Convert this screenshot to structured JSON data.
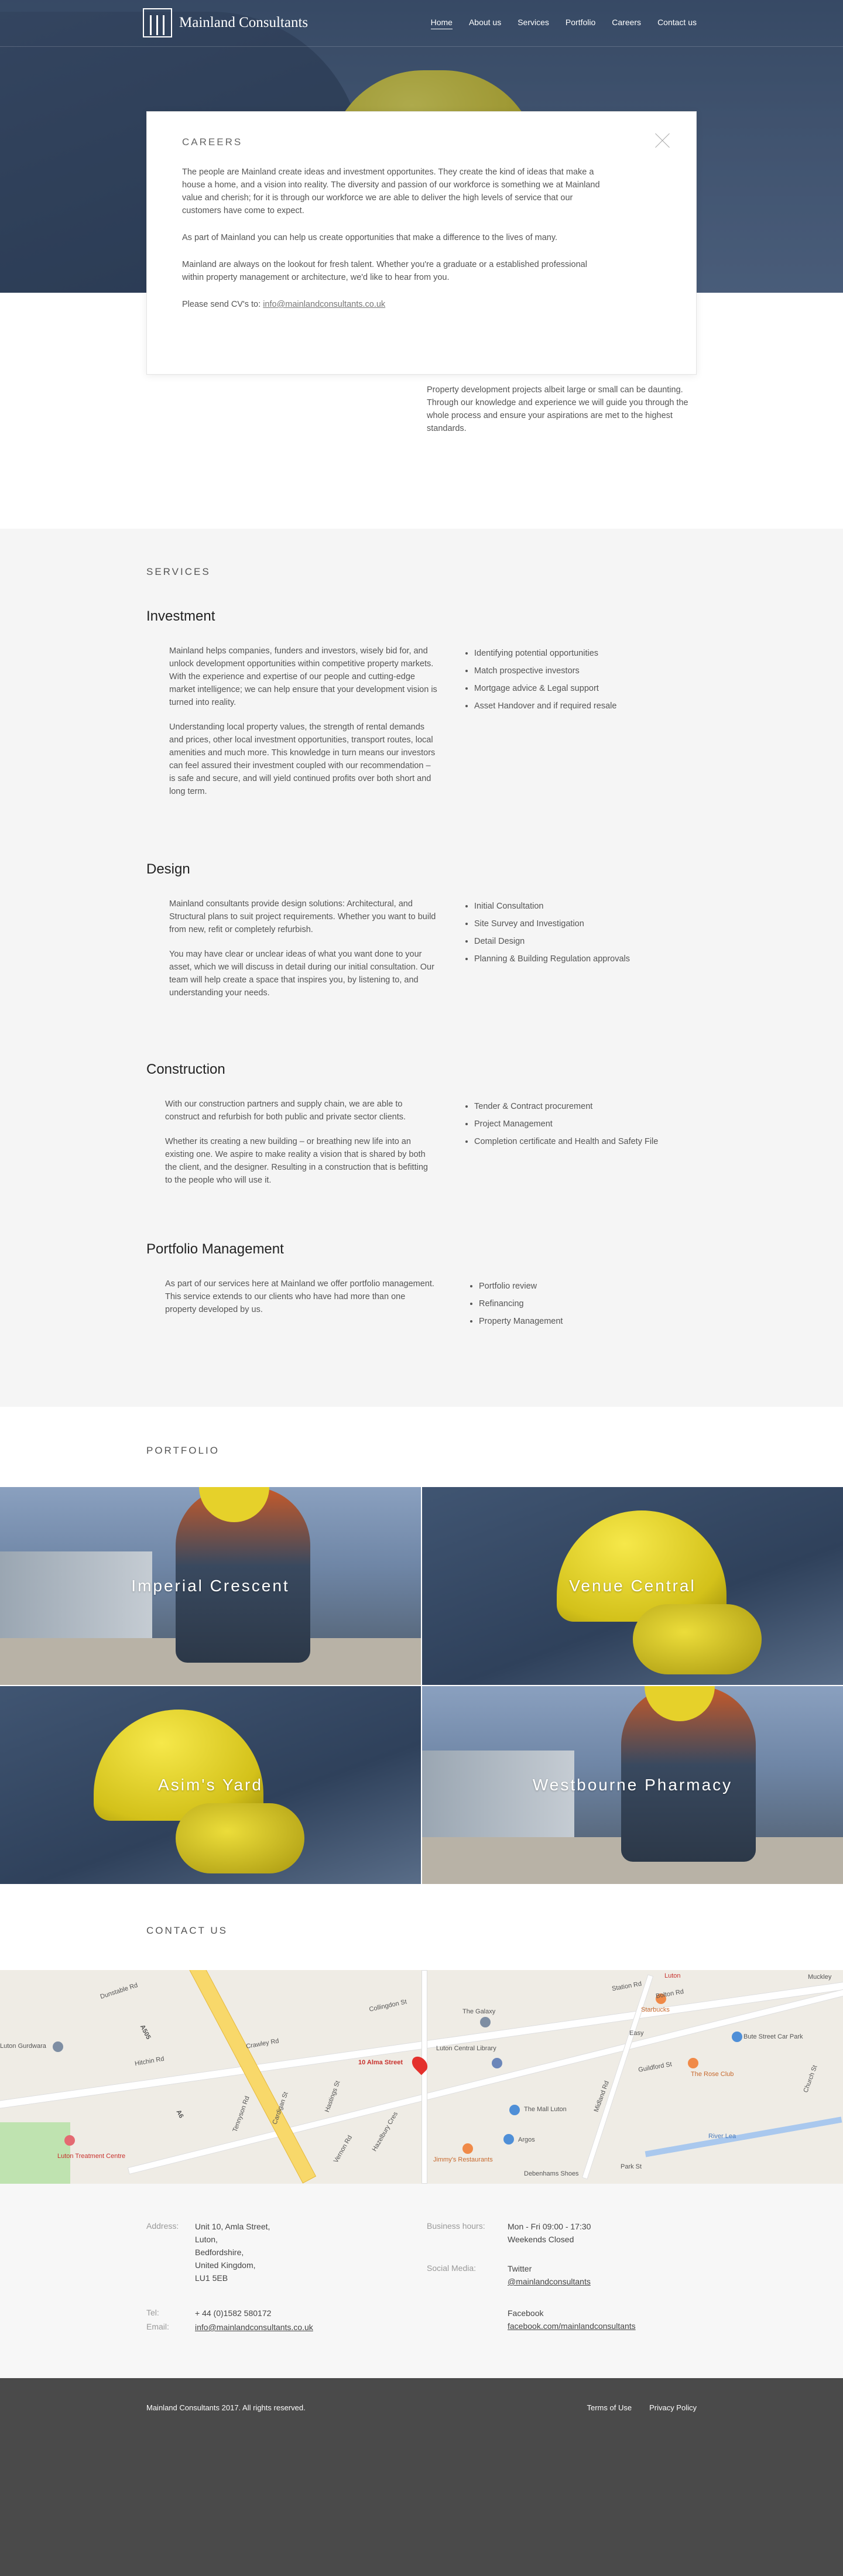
{
  "header": {
    "brand": "Mainland Consultants",
    "nav": [
      "Home",
      "About us",
      "Services",
      "Portfolio",
      "Careers",
      "Contact us"
    ]
  },
  "careers_modal": {
    "title": "CAREERS",
    "p1": "The people are Mainland create ideas and investment opportunites. They create the kind of ideas that make a house a home, and a vision into reality. The diversity and passion of our workforce is something we at Mainland value and cherish; for it is through our workforce we are able to deliver the high levels of service that our customers have come to expect.",
    "p2": "As part of Mainland you can help us create opportunities that make a difference to the lives of many.",
    "p3": "Mainland are always on the lookout for fresh talent. Whether you're a graduate or a established professional within property management or architecture, we'd like to hear from you.",
    "p4_prefix": "Please send CV's to:",
    "email": "info@mainlandconsultants.co.uk"
  },
  "intro": "Property development projects albeit large or small can be daunting. Through our knowledge and experience we will guide you through the whole process and ensure your aspirations are met to the highest standards.",
  "services": {
    "title": "SERVICES",
    "investment": {
      "heading": "Investment",
      "p1": "Mainland helps companies, funders and investors, wisely bid for, and unlock development opportunities within competitive property markets. With the experience and expertise of our people and cutting-edge market intelligence; we can help ensure that your development vision is turned into reality.",
      "p2": "Understanding local property values, the strength of rental demands and prices, other local investment opportunities, transport routes, local amenities and much more. This knowledge in turn means our investors can feel assured their investment coupled with our recommendation – is safe and secure, and will yield continued profits over both short and long term.",
      "items": [
        "Identifying potential opportunities",
        "Match prospective investors",
        "Mortgage advice & Legal support",
        "Asset Handover and if required resale"
      ]
    },
    "design": {
      "heading": "Design",
      "p1": "Mainland consultants provide design solutions: Architectural, and Structural plans to suit project requirements. Whether you want to build from new, refit or completely refurbish.",
      "p2": "You may have clear or unclear ideas of what you want done to your asset, which we will discuss in detail during our initial consultation. Our team will help create a space that inspires you, by listening to, and understanding your needs.",
      "items": [
        "Initial Consultation",
        "Site Survey and Investigation",
        "Detail Design",
        "Planning & Building Regulation approvals"
      ]
    },
    "construction": {
      "heading": "Construction",
      "p1": "With our construction partners and supply chain, we are able to construct and refurbish for both public and private sector clients.",
      "p2": "Whether its creating a new building – or breathing new life into an existing one. We aspire to make reality a vision that is shared by both the client, and the designer. Resulting in a construction that is befitting to the people who will use it.",
      "items": [
        "Tender & Contract procurement",
        "Project Management",
        "Completion certificate and Health and Safety File"
      ]
    },
    "portfolio_mgmt": {
      "heading": "Portfolio Management",
      "p1": "As part of our services here at Mainland we offer portfolio management. This service extends to our clients who have had more than one property developed by us.",
      "items": [
        "Portfolio review",
        "Refinancing",
        "Property Management"
      ]
    }
  },
  "portfolio": {
    "title": "PORTFOLIO",
    "tiles": [
      "Imperial Crescent",
      "Venue Central",
      "Asim's Yard",
      "Westbourne Pharmacy"
    ]
  },
  "contact": {
    "title": "CONTACT US",
    "map": {
      "pin_label": "10 Alma Street",
      "places": [
        "The Galaxy",
        "Luton Central Library",
        "The Mall Luton",
        "Argos",
        "Jimmy's Restaurants",
        "Debenhams Shoes",
        "Starbucks",
        "Easy",
        "Bute Street Car Park",
        "The Rose Club",
        "Luton Gurdwara",
        "Luton Treatment Centre",
        "River Lea",
        "Luton",
        "Station Rd",
        "Midland Rd",
        "Hitchin Rd",
        "Crawley Rd",
        "Dunstable Rd",
        "Collingdon St",
        "Hastings St",
        "Cardigan St",
        "Tennyson Rd",
        "Guildford St",
        "Bolton Rd",
        "Church St",
        "Park St",
        "Muckley",
        "A505",
        "A6",
        "Vernon Rd",
        "Hazelbury Cres"
      ]
    },
    "address_label": "Address:",
    "address": [
      "Unit 10, Amla Street,",
      "Luton,",
      "Bedfordshire,",
      "United Kingdom,",
      "LU1 5EB"
    ],
    "tel_label": "Tel:",
    "tel": "+ 44 (0)1582 580172",
    "email_label": "Email:",
    "email": "info@mainlandconsultants.co.uk",
    "hours_label": "Business hours:",
    "hours": [
      "Mon - Fri 09:00 - 17:30",
      "Weekends Closed"
    ],
    "social_label": "Social Media:",
    "twitter": "Twitter",
    "twitter_handle": "@mainlandconsultants",
    "facebook": "Facebook",
    "facebook_url": "facebook.com/mainlandconsultants"
  },
  "footer": {
    "copyright": "Mainland Consultants 2017. All rights reserved.",
    "links": [
      "Terms of Use",
      "Privacy Policy"
    ]
  }
}
